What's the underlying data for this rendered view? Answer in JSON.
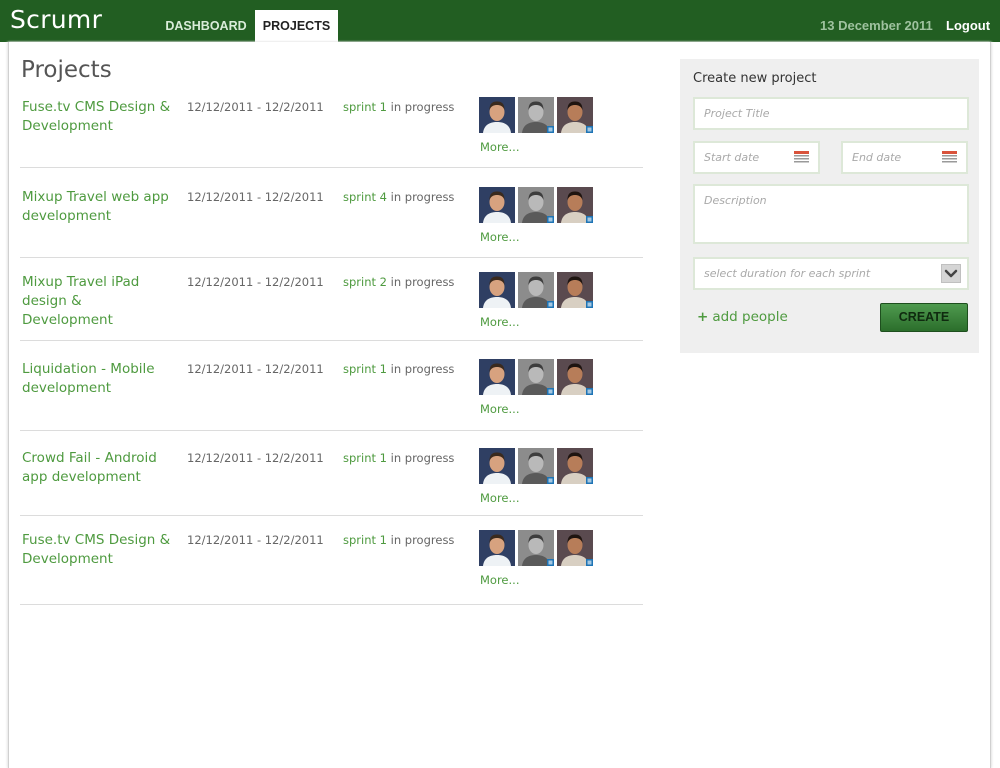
{
  "app": {
    "brand": "Scrumr"
  },
  "nav": {
    "tabs": [
      {
        "label": "DASHBOARD"
      },
      {
        "label": "PROJECTS"
      }
    ],
    "active": "PROJECTS"
  },
  "header": {
    "date": "13 December 2011",
    "logout": "Logout"
  },
  "page": {
    "title": "Projects"
  },
  "projects": [
    {
      "name": "Fuse.tv CMS Design & Development",
      "dates": "12/12/2011 - 12/2/2011",
      "sprint_label": "sprint 1",
      "status": "in progress",
      "more": "More..."
    },
    {
      "name": "Mixup Travel web app development",
      "dates": "12/12/2011 - 12/2/2011",
      "sprint_label": "sprint 4",
      "status": "in progress",
      "more": "More..."
    },
    {
      "name": "Mixup Travel iPad design & Development",
      "dates": "12/12/2011 - 12/2/2011",
      "sprint_label": "sprint 2",
      "status": "in progress",
      "more": "More..."
    },
    {
      "name": "Liquidation - Mobile development",
      "dates": "12/12/2011 - 12/2/2011",
      "sprint_label": "sprint 1",
      "status": "in progress",
      "more": "More..."
    },
    {
      "name": "Crowd Fail - Android app development",
      "dates": "12/12/2011 - 12/2/2011",
      "sprint_label": "sprint 1",
      "status": "in progress",
      "more": "More..."
    },
    {
      "name": "Fuse.tv CMS Design & Development",
      "dates": "12/12/2011 - 12/2/2011",
      "sprint_label": "sprint 1",
      "status": "in progress",
      "more": "More..."
    }
  ],
  "create_form": {
    "title": "Create new project",
    "project_title_placeholder": "Project Title",
    "start_date_placeholder": "Start date",
    "end_date_placeholder": "End date",
    "description_placeholder": "Description",
    "duration_placeholder": "select duration for each sprint",
    "add_people": "add people",
    "create_button": "CREATE"
  },
  "icons": {
    "calendar": "calendar-icon",
    "chevron": "chevron-down-icon",
    "plus": "plus-icon",
    "linkedin_badge": "linkedin-badge-icon"
  },
  "colors": {
    "header_bg": "#225e22",
    "link_green": "#4e9a3f",
    "panel_bg": "#efefef",
    "button_green": "#3f8a3f"
  }
}
